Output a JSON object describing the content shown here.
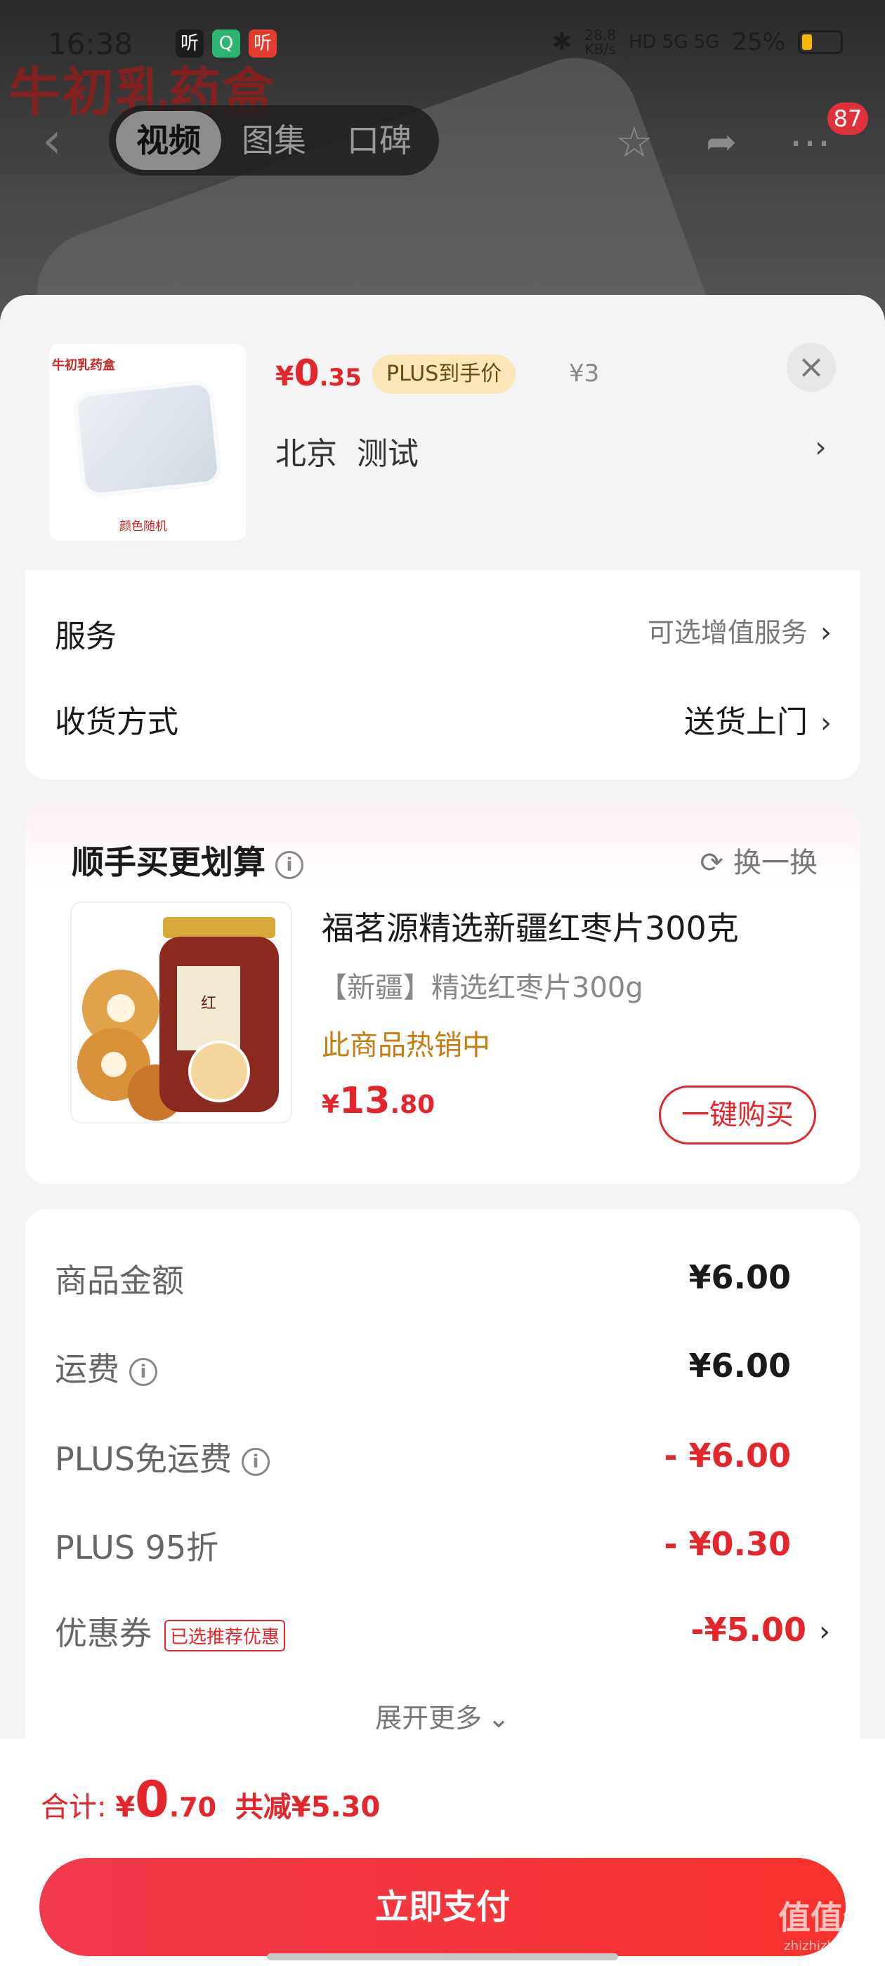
{
  "status_bar": {
    "time": "16:38",
    "app_icons": [
      "听",
      "Q",
      "听"
    ],
    "speed": "28.8\nKB/s",
    "network": "HD 5G 5G",
    "battery": "25%"
  },
  "header": {
    "watermark_title": "牛初乳药盒",
    "tabs": [
      "视频",
      "图集",
      "口碑"
    ],
    "active_tab": "视频",
    "badge_count": "87"
  },
  "product": {
    "thumb_label": "牛初乳药盒",
    "thumb_note": "颜色随机",
    "price_currency": "¥",
    "price_int": "0",
    "price_dec": ".35",
    "plus_tag": "PLUS到手价",
    "orig_price": "¥3",
    "address": "北京  测试"
  },
  "options": {
    "service_label": "服务",
    "service_value": "可选增值服务",
    "delivery_label": "收货方式",
    "delivery_value": "送货上门"
  },
  "upsell": {
    "title": "顺手买更划算",
    "swap_label": "换一换",
    "name": "福茗源精选新疆红枣片300克",
    "sub": "【新疆】精选红枣片300g",
    "hot": "此商品热销中",
    "price_currency": "¥",
    "price_int": "13",
    "price_dec": ".80",
    "buy_label": "一键购买"
  },
  "fees": {
    "goods_label": "商品金额",
    "goods_amount": "¥6.00",
    "shipping_label": "运费",
    "shipping_amount": "¥6.00",
    "plus_free_label": "PLUS免运费",
    "plus_free_amount": "- ¥6.00",
    "plus_discount_label": "PLUS 95折",
    "plus_discount_amount": "- ¥0.30",
    "coupon_label": "优惠券",
    "coupon_tag": "已选推荐优惠",
    "coupon_amount": "-¥5.00",
    "expand_label": "展开更多"
  },
  "footer": {
    "total_label": "合计:",
    "total_currency": "¥",
    "total_int": "0",
    "total_dec": ".70",
    "saved": "共减¥5.30",
    "pay_label": "立即支付"
  },
  "watermark": {
    "main": "值值值",
    "sub": "zhizhizhi.com"
  },
  "colors": {
    "accent_red": "#e4262c",
    "plus_gold": "#fbe7b8",
    "hot_orange": "#c77d10"
  },
  "icons": [
    "back-arrow-icon",
    "star-icon",
    "share-icon",
    "more-icon",
    "close-icon",
    "chevron-right-icon",
    "info-icon",
    "refresh-icon",
    "chevron-down-icon"
  ]
}
